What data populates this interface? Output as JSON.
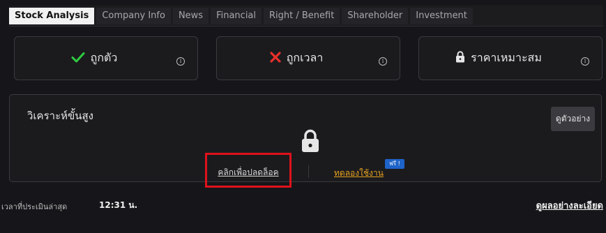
{
  "tabs": [
    {
      "label": "Stock Analysis",
      "active": true
    },
    {
      "label": "Company Info"
    },
    {
      "label": "News"
    },
    {
      "label": "Financial"
    },
    {
      "label": "Right / Benefit"
    },
    {
      "label": "Shareholder"
    },
    {
      "label": "Investment"
    }
  ],
  "cards": [
    {
      "label": "ถูกตัว",
      "icon": "check-icon",
      "icon_color": "#2ecc40"
    },
    {
      "label": "ถูกเวลา",
      "icon": "cross-icon",
      "icon_color": "#e8302a"
    },
    {
      "label": "ราคาเหมาะสม",
      "icon": "lock-icon",
      "icon_color": "#e6e6e6"
    }
  ],
  "info_glyph": "i",
  "advanced": {
    "title": "วิเคราะห์ขั้นสูง",
    "example_button": "ดูตัวอย่าง",
    "unlock_link": "คลิกเพื่อปลดล็อค",
    "trial_link": "ทดลองใช้งาน",
    "free_badge": "ฟรี !"
  },
  "footer": {
    "last_eval_label": "เวลาที่ประเมินล่าสุด",
    "time": "12:31 น.",
    "detail_link": "ดูผลอย่างละเอียด"
  },
  "colors": {
    "highlight_border": "#e0121b",
    "trial_link": "#e7a21e",
    "free_badge": "#1e63c9"
  }
}
